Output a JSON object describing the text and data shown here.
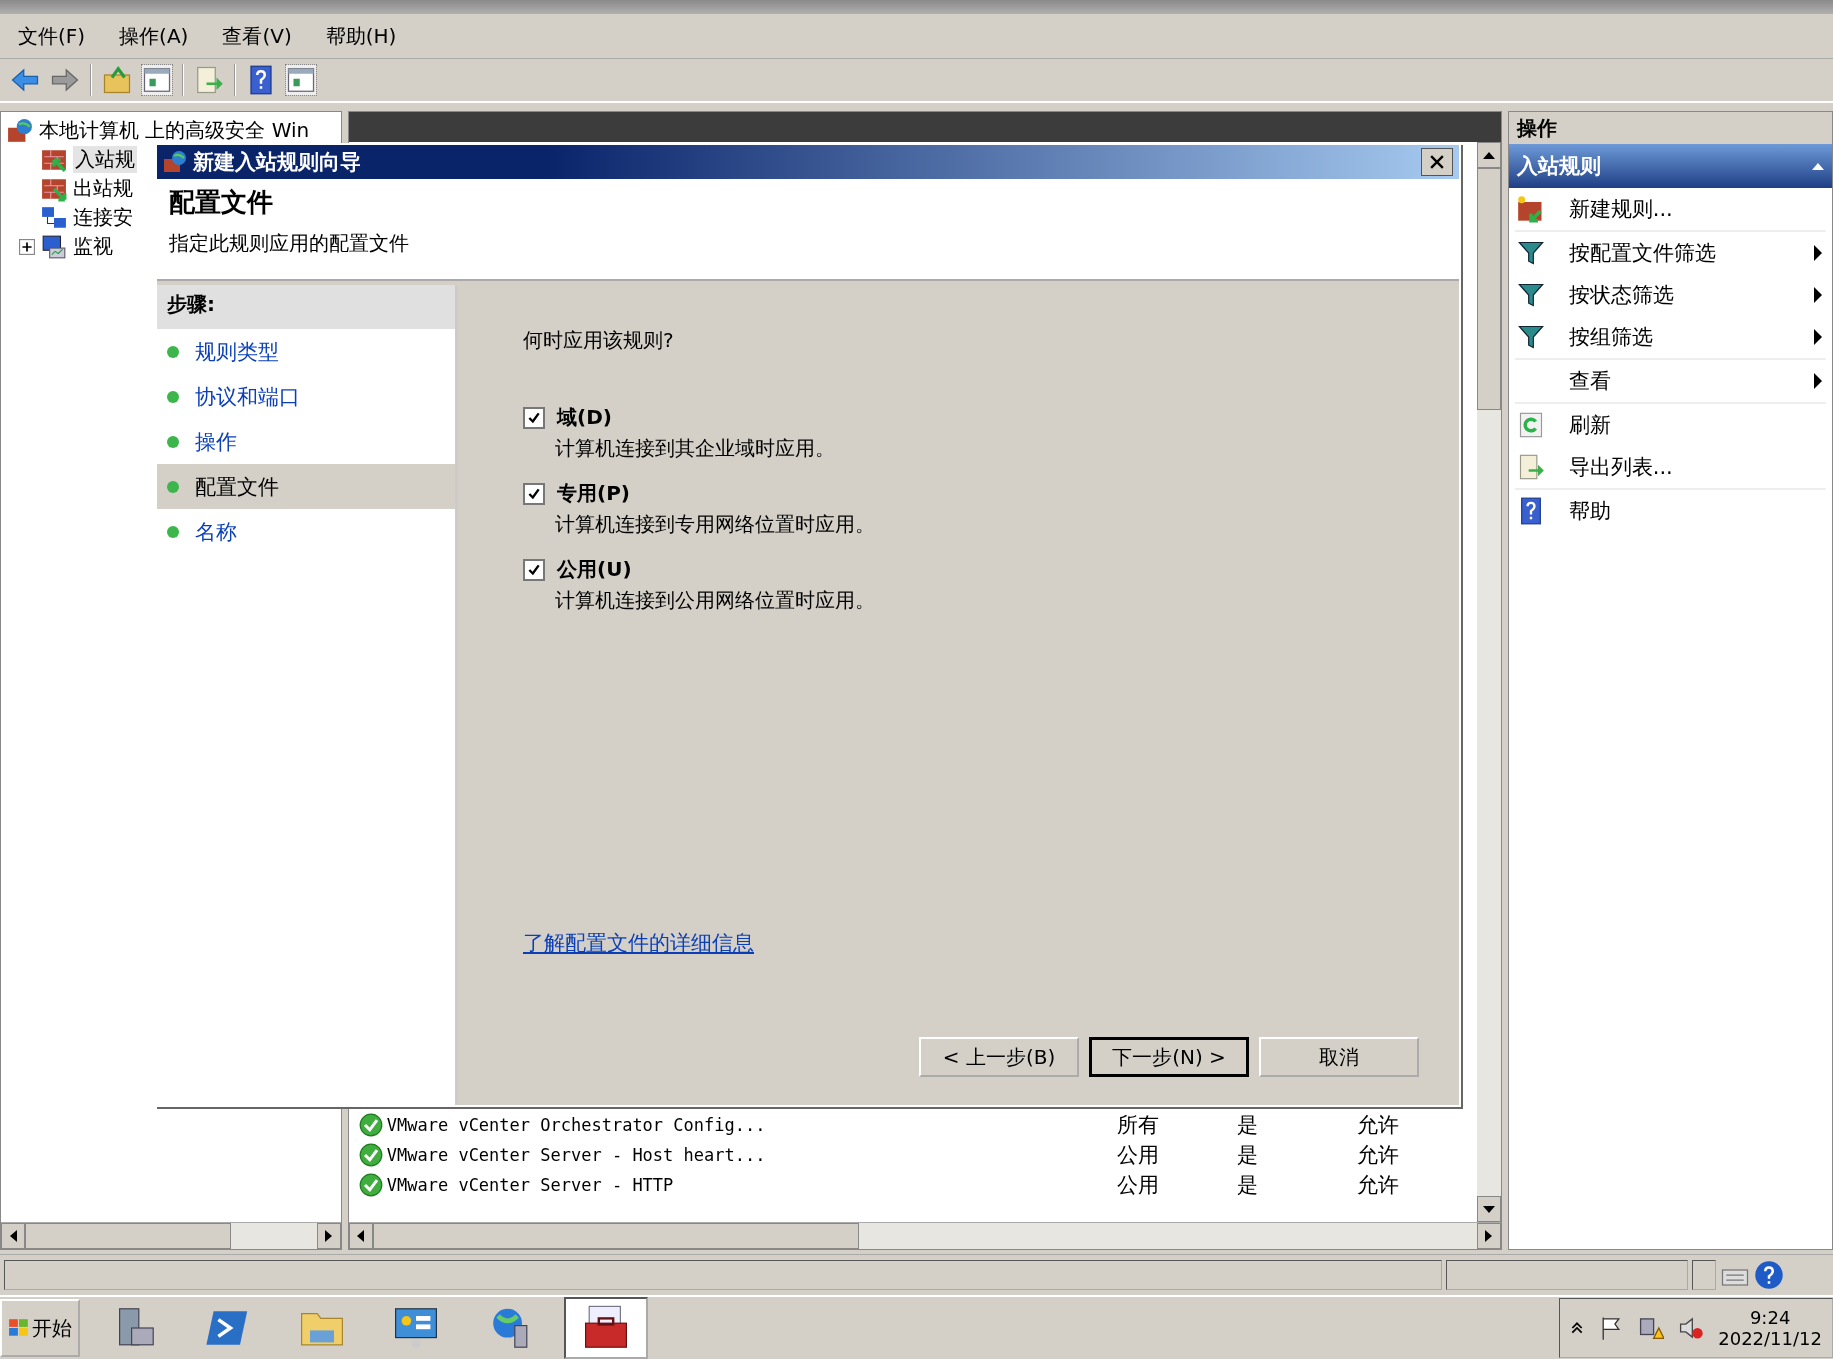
{
  "menu": [
    "文件(F)",
    "操作(A)",
    "查看(V)",
    "帮助(H)"
  ],
  "toolbar": [
    {
      "kind": "back"
    },
    {
      "kind": "forward"
    },
    {
      "kind": "sep"
    },
    {
      "kind": "up"
    },
    {
      "kind": "pane"
    },
    {
      "kind": "sep"
    },
    {
      "kind": "export"
    },
    {
      "kind": "sep"
    },
    {
      "kind": "help"
    },
    {
      "kind": "pane"
    }
  ],
  "tree": {
    "label": "本地计算机 上的高级安全 Win",
    "children": [
      {
        "label": "入站规",
        "kind": "inbound",
        "selected": true
      },
      {
        "label": "出站规",
        "kind": "outbound",
        "selected": false
      },
      {
        "label": "连接安",
        "kind": "connection",
        "selected": false
      },
      {
        "label": "监视",
        "kind": "monitor",
        "selected": false,
        "expanded": false
      }
    ]
  },
  "rules": [
    {
      "name": "VMware vCenter Orchestrator Config...",
      "profile": "所有",
      "enabled": "是",
      "action": "允许"
    },
    {
      "name": "VMware vCenter Server - Host heart...",
      "profile": "公用",
      "enabled": "是",
      "action": "允许"
    },
    {
      "name": "VMware vCenter Server - HTTP",
      "profile": "公用",
      "enabled": "是",
      "action": "允许"
    }
  ],
  "actions": {
    "title": "操作",
    "section": {
      "label": "入站规则",
      "expanded": true
    },
    "items": [
      {
        "label": "新建规则...",
        "kind": "new",
        "submenu": false,
        "divider_after": true
      },
      {
        "label": "按配置文件筛选",
        "kind": "filter",
        "submenu": true,
        "divider_after": false
      },
      {
        "label": "按状态筛选",
        "kind": "filter",
        "submenu": true,
        "divider_after": false
      },
      {
        "label": "按组筛选",
        "kind": "filter",
        "submenu": true,
        "divider_after": true
      },
      {
        "label": "查看",
        "kind": "none",
        "submenu": true,
        "divider_after": true
      },
      {
        "label": "刷新",
        "kind": "refresh",
        "submenu": false,
        "divider_after": false
      },
      {
        "label": "导出列表...",
        "kind": "export",
        "submenu": false,
        "divider_after": true
      },
      {
        "label": "帮助",
        "kind": "help",
        "submenu": false,
        "divider_after": false
      }
    ]
  },
  "dialog": {
    "title": "新建入站规则向导",
    "heading": "配置文件",
    "subtitle": "指定此规则应用的配置文件",
    "steps_title": "步骤:",
    "steps": [
      {
        "label": "规则类型",
        "selected": false
      },
      {
        "label": "协议和端口",
        "selected": false
      },
      {
        "label": "操作",
        "selected": false
      },
      {
        "label": "配置文件",
        "selected": true
      },
      {
        "label": "名称",
        "selected": false
      }
    ],
    "question": "何时应用该规则?",
    "options": [
      {
        "label": "域(D)",
        "description": "计算机连接到其企业域时应用。",
        "checked": true
      },
      {
        "label": "专用(P)",
        "description": "计算机连接到专用网络位置时应用。",
        "checked": true
      },
      {
        "label": "公用(U)",
        "description": "计算机连接到公用网络位置时应用。",
        "checked": true
      }
    ],
    "link": "了解配置文件的详细信息",
    "buttons": [
      {
        "label": "< 上一步(B)",
        "default": false
      },
      {
        "label": "下一步(N) >",
        "default": true
      },
      {
        "label": "取消",
        "default": false
      }
    ]
  },
  "taskbar": {
    "start": "开始",
    "apps": [
      {
        "kind": "server",
        "selected": false
      },
      {
        "kind": "shell",
        "selected": false
      },
      {
        "kind": "folder",
        "selected": false
      },
      {
        "kind": "panel",
        "selected": false
      },
      {
        "kind": "globe",
        "selected": false
      },
      {
        "kind": "toolbox",
        "selected": true
      }
    ],
    "time": "9:24",
    "date": "2022/11/12"
  }
}
